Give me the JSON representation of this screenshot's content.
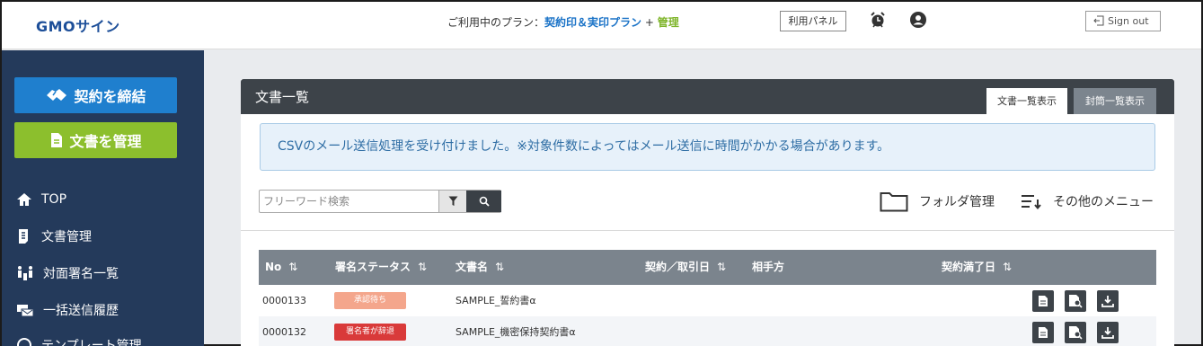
{
  "header": {
    "logo": "GMOサイン",
    "plan_prefix": "ご利用中のプラン：",
    "plan_main": "契約印＆実印プラン",
    "plan_plus": " + ",
    "plan_extra": "管理",
    "panel_label": "利用パネル",
    "signout_label": "Sign out",
    "icons": [
      "alarm-clock-icon",
      "user-icon",
      "sign-out-icon"
    ]
  },
  "sidebar": {
    "primary_button": "契約を締結",
    "secondary_button": "文書を管理",
    "items": [
      {
        "label": "TOP",
        "icon": "home-icon"
      },
      {
        "label": "文書管理",
        "icon": "document-icon"
      },
      {
        "label": "対面署名一覧",
        "icon": "face-to-face-icon"
      },
      {
        "label": "一括送信履歴",
        "icon": "bulk-send-icon"
      },
      {
        "label": "テンプレート管理",
        "icon": "template-icon"
      }
    ],
    "colors": {
      "background": "#243a5b",
      "primary": "#1f7fce",
      "secondary": "#8cbf2d"
    }
  },
  "main": {
    "title": "文書一覧",
    "tabs": [
      {
        "label": "文書一覧表示",
        "active": true
      },
      {
        "label": "封筒一覧表示",
        "active": false
      }
    ],
    "alert": "CSVのメール送信処理を受け付けました。※対象件数によってはメール送信に時間がかかる場合があります。",
    "search": {
      "placeholder": "フリーワード検索"
    },
    "folder_label": "フォルダ管理",
    "menu_label": "その他のメニュー",
    "table": {
      "columns": [
        "No",
        "署名ステータス",
        "文書名",
        "契約／取引日",
        "相手方",
        "契約満了日"
      ],
      "sort_icon": "⇅",
      "rows": [
        {
          "no": "0000133",
          "status": "承認待ち",
          "status_color": "#f4a68c",
          "name": "SAMPLE_誓約書α",
          "date": "",
          "party": "",
          "expiry": ""
        },
        {
          "no": "0000132",
          "status": "署名者が辞退",
          "status_color": "#d93a3a",
          "name": "SAMPLE_機密保持契約書α",
          "date": "",
          "party": "",
          "expiry": ""
        }
      ]
    }
  }
}
